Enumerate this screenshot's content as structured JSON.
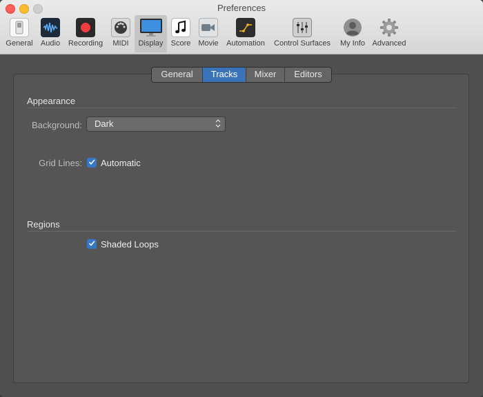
{
  "window": {
    "title": "Preferences"
  },
  "toolbar": {
    "items": [
      {
        "label": "General",
        "icon": "switch-icon"
      },
      {
        "label": "Audio",
        "icon": "waveform-icon"
      },
      {
        "label": "Recording",
        "icon": "record-icon"
      },
      {
        "label": "MIDI",
        "icon": "midi-port-icon"
      },
      {
        "label": "Display",
        "icon": "monitor-icon",
        "selected": true
      },
      {
        "label": "Score",
        "icon": "music-note-icon"
      },
      {
        "label": "Movie",
        "icon": "video-camera-icon"
      },
      {
        "label": "Automation",
        "icon": "automation-curve-icon"
      },
      {
        "label": "Control Surfaces",
        "icon": "faders-icon"
      },
      {
        "label": "My Info",
        "icon": "user-silhouette-icon"
      },
      {
        "label": "Advanced",
        "icon": "gear-icon"
      }
    ]
  },
  "tabs": [
    {
      "label": "General"
    },
    {
      "label": "Tracks",
      "active": true
    },
    {
      "label": "Mixer"
    },
    {
      "label": "Editors"
    }
  ],
  "appearance": {
    "title": "Appearance",
    "background_label": "Background:",
    "background_value": "Dark",
    "grid_lines_label": "Grid Lines:",
    "grid_lines_checkbox_label": "Automatic",
    "grid_lines_checked": true
  },
  "regions": {
    "title": "Regions",
    "shaded_loops_label": "Shaded Loops",
    "shaded_loops_checked": true
  },
  "colors": {
    "accent": "#3478c6",
    "tab_active": "#3a73b7",
    "panel_bg": "#555555"
  }
}
